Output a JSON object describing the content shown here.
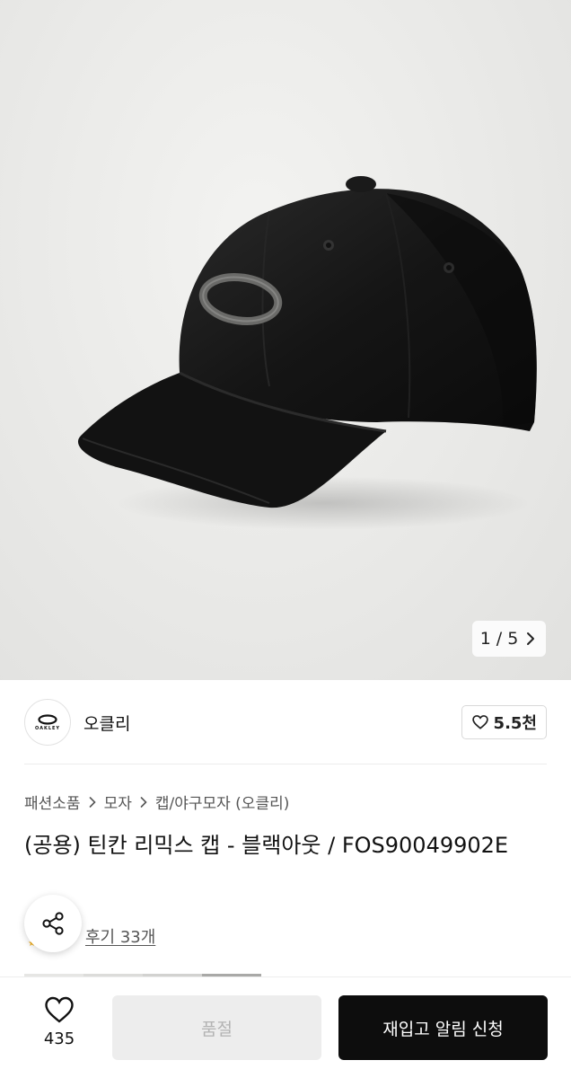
{
  "gallery": {
    "current_page": "1",
    "separator": "/",
    "total_pages": "5",
    "image_subject": "cap-photo"
  },
  "brand": {
    "logo_text": "OAKLEY",
    "name": "오클리",
    "likes": "5.5천"
  },
  "breadcrumb": [
    "패션소품",
    "모자",
    "캡/야구모자 (오클리)"
  ],
  "product": {
    "title": "(공용) 틴칸 리믹스 캡 - 블랙아웃 / FOS90049902E",
    "reviews": "후기 33개"
  },
  "bottom_bar": {
    "wish_count": "435",
    "soldout_label": "품절",
    "restock_label": "재입고 알림 신청"
  },
  "colors": {
    "accent": "#0d0d0d",
    "disabled_bg": "#ededed",
    "disabled_text": "#b3b3b3",
    "star": "#f2b01e"
  },
  "icons": [
    "chevron-right-icon",
    "heart-outline-icon",
    "share-icon",
    "star-icon"
  ]
}
